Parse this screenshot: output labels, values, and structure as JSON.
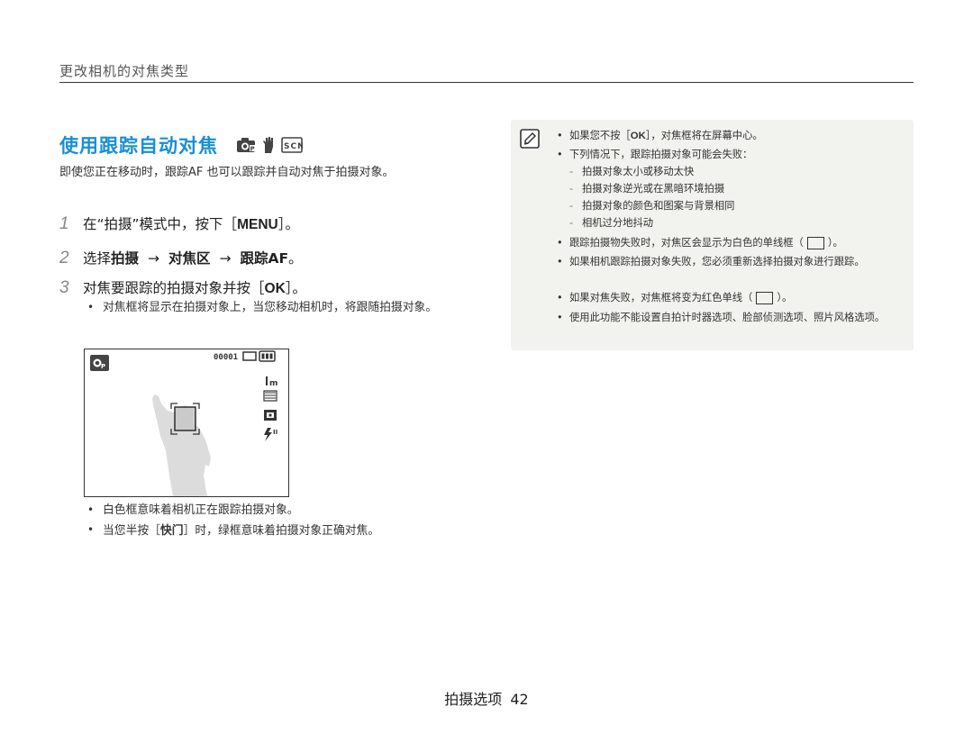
{
  "header": {
    "title": "更改相机的对焦类型"
  },
  "section": {
    "title": "使用跟踪自动对焦"
  },
  "icons": {
    "mode": [
      "camera-program-icon",
      "hand-dis-icon",
      "scene-icon"
    ],
    "note": "note-pencil-icon"
  },
  "intro": "即使您正在移动时，跟踪AF 也可以跟踪并自动对焦于拍摄对象。",
  "steps": [
    {
      "num": "1",
      "pre": "在“拍摄”模式中，按下［",
      "key": "MENU",
      "post": "］。"
    },
    {
      "num": "2",
      "pre": "选择",
      "b1": "拍摄",
      "arrow1": "→",
      "b2": "对焦区",
      "arrow2": "→",
      "b3": "跟踪AF",
      "post": "。"
    },
    {
      "num": "3",
      "pre": "对焦要跟踪的拍摄对象并按［",
      "key": "OK",
      "post": "］。"
    }
  ],
  "step3_bullet": "对焦框将显示在拍摄对象上，当您移动相机时，将跟随拍摄对象。",
  "viewfinder": {
    "counter": "00001"
  },
  "bottom_bullets": [
    {
      "text": "白色框意味着相机正在跟踪拍摄对象。"
    },
    {
      "pre": "当您半按［",
      "key": "快门",
      "post": "］时，绿框意味着拍摄对象正确对焦。"
    }
  ],
  "notes": {
    "item1": {
      "pre": "如果您不按［",
      "key": "OK",
      "post": "］，对焦框将在屏幕中心。"
    },
    "item2": "下列情况下，跟踪拍摄对象可能会失败：",
    "sub_items": [
      "拍摄对象太小或移动太快",
      "拍摄对象逆光或在黑暗环境拍摄",
      "拍摄对象的颜色和图案与背景相同",
      "相机过分地抖动"
    ],
    "sub_dash": "-",
    "item3": {
      "pre": "跟踪拍摄物失败时，对焦区会显示为白色的单线框（",
      "post": "）。"
    },
    "item4": "如果相机跟踪拍摄对象失败，您必须重新选择拍摄对象进行跟踪。",
    "item5": {
      "pre": "如果对焦失败，对焦框将变为红色单线（",
      "post": "）。"
    },
    "item6": "使用此功能不能设置自拍计时器选项、脸部侦测选项、照片风格选项。"
  },
  "footer": {
    "label": "拍摄选项",
    "page": "42"
  }
}
